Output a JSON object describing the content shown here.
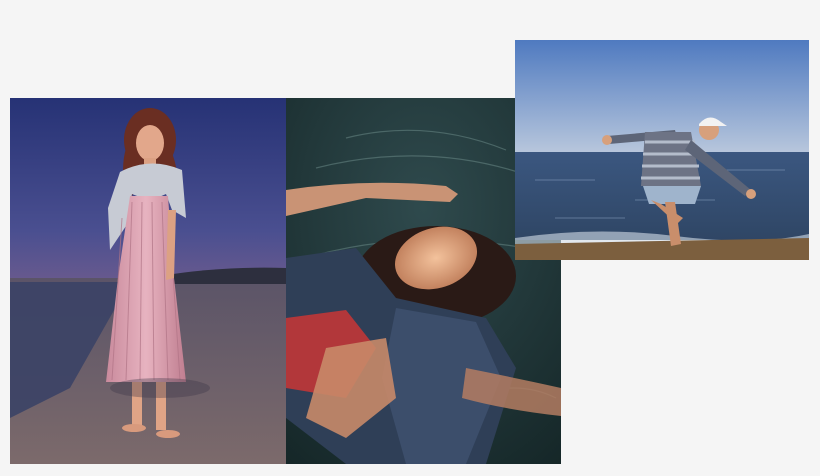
{
  "gallery": {
    "photos": [
      {
        "subject": "woman-in-striped-dress-on-beach-at-dusk"
      },
      {
        "subject": "person-floating-in-water"
      },
      {
        "subject": "person-balancing-by-the-sea"
      }
    ]
  },
  "colors": {
    "page_background": "#f5f5f5",
    "dusk_sky": "#3f4f8f",
    "sea_blue": "#3d5a80",
    "clear_sky": "#6f9bd3",
    "dress_pink": "#d99aa8",
    "swimsuit_red": "#b2373a",
    "skin_warm": "#d9a17f"
  }
}
